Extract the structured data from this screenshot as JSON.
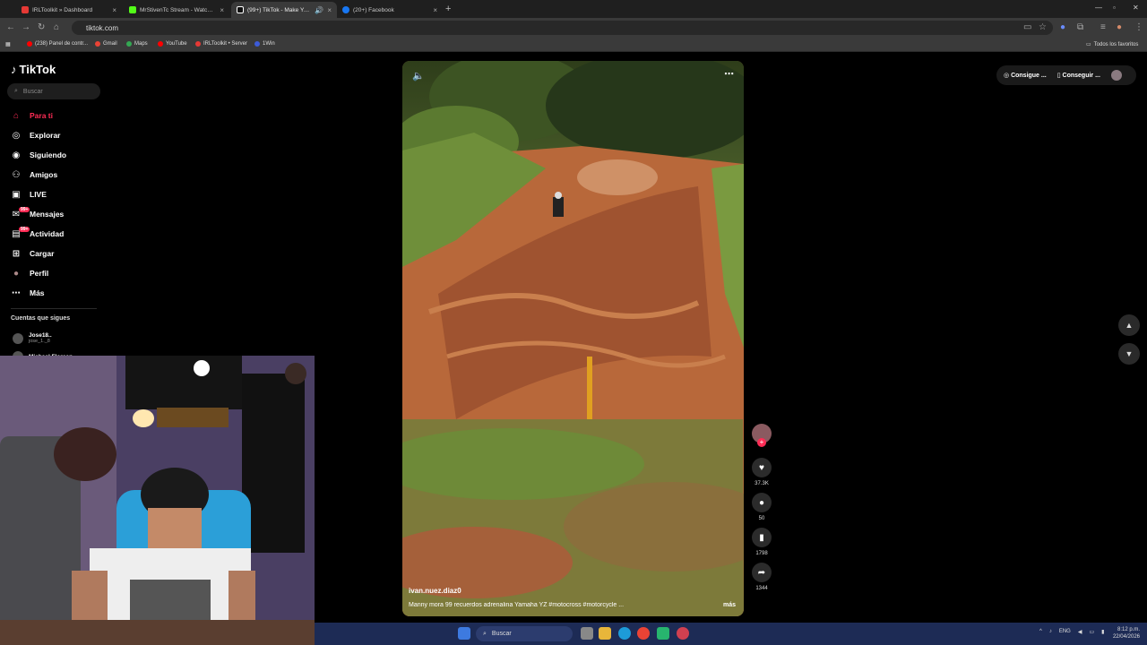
{
  "browser": {
    "tabs": [
      {
        "title": "IRLToolkit » Dashboard",
        "color": "#e53935"
      },
      {
        "title": "MrStivenTc Stream - Watch Live",
        "color": "#53fc18"
      },
      {
        "title": "(99+) TikTok - Make Your Day",
        "color": "#000000"
      },
      {
        "title": "(20+) Facebook",
        "color": "#1877f2"
      }
    ],
    "new_tab": "+",
    "url": "tiktok.com",
    "bookmarks": [
      {
        "label": "(238) Panel de contr...",
        "color": "#ff0000"
      },
      {
        "label": "Gmail",
        "color": "#ea4335"
      },
      {
        "label": "Maps",
        "color": "#34a853"
      },
      {
        "label": "YouTube",
        "color": "#ff0000"
      },
      {
        "label": "IRLToolkit • Server",
        "color": "#e53935"
      },
      {
        "label": "1Win",
        "color": "#3c5bd8"
      }
    ],
    "all_bookmarks": "Todos los favoritos"
  },
  "sidebar": {
    "logo": "TikTok",
    "search_placeholder": "Buscar",
    "nav": [
      {
        "label": "Para ti",
        "icon": "home-icon"
      },
      {
        "label": "Explorar",
        "icon": "compass-icon"
      },
      {
        "label": "Siguiendo",
        "icon": "following-icon"
      },
      {
        "label": "Amigos",
        "icon": "friends-icon"
      },
      {
        "label": "LIVE",
        "icon": "live-icon"
      },
      {
        "label": "Mensajes",
        "icon": "messages-icon",
        "badge": "99+"
      },
      {
        "label": "Actividad",
        "icon": "activity-icon",
        "badge": "99+"
      },
      {
        "label": "Cargar",
        "icon": "upload-icon"
      },
      {
        "label": "Perfil",
        "icon": "profile-icon"
      },
      {
        "label": "Más",
        "icon": "more-icon"
      }
    ],
    "following_title": "Cuentas que sigues",
    "accounts": [
      {
        "name": "Jose18..",
        "handle": "jose_1._8"
      },
      {
        "name": "Michael Florean",
        "handle": ""
      }
    ]
  },
  "video": {
    "username": "ivan.nuez.diaz0",
    "caption": "Manny mora 99 recuerdos adrenalina Yamaha YZ  #motocross  #motorcycle ...",
    "more": "más",
    "likes": "37.3K",
    "comments": "50",
    "saves": "1798",
    "shares": "1344"
  },
  "top_right": {
    "btn1": "Consigue ...",
    "btn2": "Conseguir ..."
  },
  "taskbar": {
    "search": "Buscar",
    "lang": "ENG",
    "time": "8:12 p.m.",
    "date": "22/04/2026"
  }
}
